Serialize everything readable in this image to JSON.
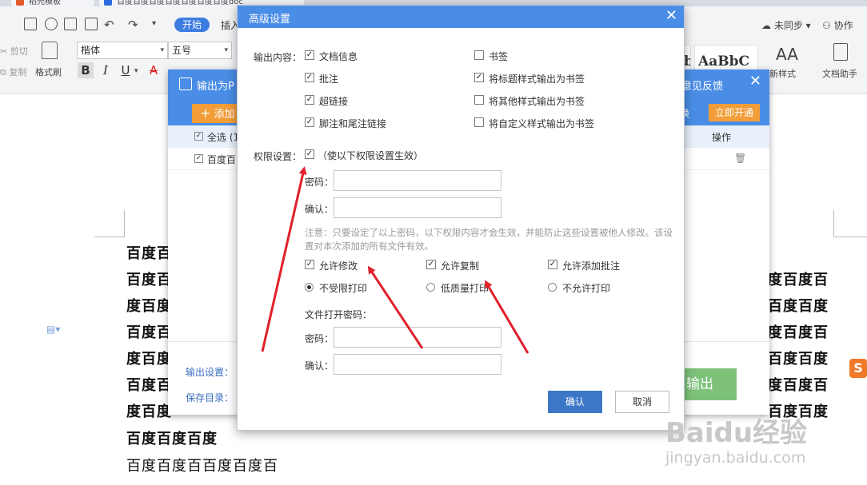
{
  "tabs": [
    {
      "label": "稻壳模板",
      "color": "#e25b2c"
    },
    {
      "label": "百度百度百度百度百度百度百度doc",
      "color": "#2d6ce0"
    }
  ],
  "ribbon": {
    "start_tab": "开始",
    "insert_tab": "插入",
    "cut": "剪切",
    "copy": "复制",
    "format_painter": "格式刷",
    "font_name": "楷体",
    "font_size": "五号",
    "bold": "B",
    "italic": "I",
    "underline": "U",
    "style_preview_1": "b(",
    "style_preview_2": "AaBbC",
    "new_style": "新样式",
    "doc_assistant": "文档助手",
    "sync": "未同步",
    "collab": "协作",
    "style_glyph": "AA"
  },
  "document": {
    "lines": [
      "百度百",
      "百度百",
      "度百度",
      "百度百",
      "度百度",
      "百度百",
      "度百度",
      "百度百度百度"
    ],
    "right_lines": [
      "度百度百",
      "百度百度",
      "度百度百",
      "百度百度",
      "度百度百",
      "百度百度"
    ],
    "last_line": "百度百度百百度百度百"
  },
  "pdf_dialog": {
    "title": "输出为P",
    "feedback": "意见反馈",
    "add_button": "添加",
    "switch_text": "换",
    "open_button": "立即开通",
    "select_all": "全选 (1",
    "op_header": "操作",
    "file_row": "百度百",
    "output_settings": "输出设置：",
    "save_dir": "保存目录：",
    "export_button": "输出"
  },
  "advanced_dialog": {
    "title": "高级设置",
    "output_content_label": "输出内容：",
    "options_left": [
      {
        "label": "文档信息",
        "checked": true
      },
      {
        "label": "批注",
        "checked": true
      },
      {
        "label": "超链接",
        "checked": true
      },
      {
        "label": "脚注和尾注链接",
        "checked": true
      }
    ],
    "options_right": [
      {
        "label": "书签",
        "checked": false
      },
      {
        "label": "将标题样式输出为书签",
        "checked": true
      },
      {
        "label": "将其他样式输出为书签",
        "checked": false
      },
      {
        "label": "将自定义样式输出为书签",
        "checked": false
      }
    ],
    "permission_label": "权限设置：",
    "permission_hint": "（使以下权限设置生效）",
    "permission_checked": true,
    "password_label": "密码：",
    "confirm_label": "确认：",
    "note": "注意：只要设定了以上密码，以下权限内容才会生效，并能防止这些设置被他人修改。该设置对本次添加的所有文件有效。",
    "allow_edit": "允许修改",
    "allow_copy": "允许复制",
    "allow_comment": "允许添加批注",
    "print_unlimited": "不受限打印",
    "print_low": "低质量打印",
    "print_none": "不允许打印",
    "open_password_label": "文件打开密码：",
    "open_password_field": "密码：",
    "open_confirm_field": "确认：",
    "ok_button": "确认",
    "cancel_button": "取消"
  },
  "watermark": {
    "brand": "Baidu经验",
    "url": "jingyan.baidu.com"
  },
  "colors": {
    "dialog_header": "#4a8de6",
    "accent_orange": "#f29d38",
    "arrow": "#e0202a"
  }
}
